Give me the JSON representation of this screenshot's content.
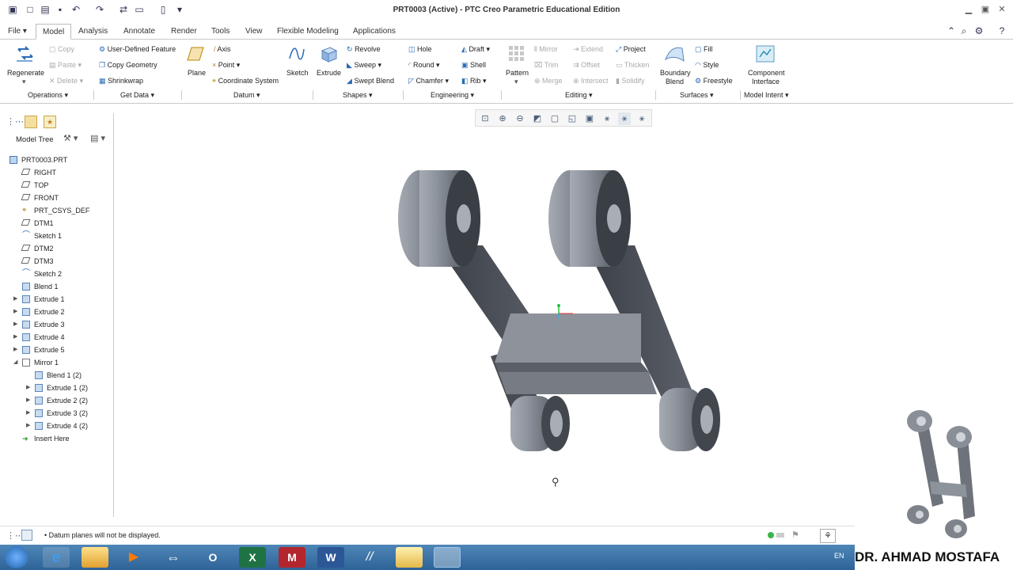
{
  "window": {
    "title": "PRT0003 (Active) - PTC Creo Parametric Educational Edition"
  },
  "tabs": [
    "File",
    "Model",
    "Analysis",
    "Annotate",
    "Render",
    "Tools",
    "View",
    "Flexible Modeling",
    "Applications"
  ],
  "ribbon": {
    "regenerate": "Regenerate",
    "copy": "Copy",
    "paste": "Paste",
    "delete": "Delete",
    "udf": "User-Defined Feature",
    "copy_geometry": "Copy Geometry",
    "shrinkwrap": "Shrinkwrap",
    "plane": "Plane",
    "axis": "Axis",
    "point": "Point",
    "coordinate_system": "Coordinate System",
    "sketch": "Sketch",
    "extrude": "Extrude",
    "revolve": "Revolve",
    "sweep": "Sweep",
    "swept_blend": "Swept Blend",
    "hole": "Hole",
    "round": "Round",
    "chamfer": "Chamfer",
    "draft": "Draft",
    "shell": "Shell",
    "rib": "Rib",
    "pattern": "Pattern",
    "mirror": "Mirror",
    "trim": "Trim",
    "merge": "Merge",
    "extend": "Extend",
    "offset": "Offset",
    "intersect": "Intersect",
    "project": "Project",
    "thicken": "Thicken",
    "solidify": "Solidify",
    "boundary_blend_1": "Boundary",
    "boundary_blend_2": "Blend",
    "fill": "Fill",
    "style": "Style",
    "freestyle": "Freestyle",
    "component_interface_1": "Component",
    "component_interface_2": "Interface",
    "groups": [
      "Operations",
      "Get Data",
      "Datum",
      "Shapes",
      "Engineering",
      "Editing",
      "Surfaces",
      "Model Intent"
    ]
  },
  "model_tree": {
    "header": "Model Tree",
    "items": [
      "PRT0003.PRT",
      "RIGHT",
      "TOP",
      "FRONT",
      "PRT_CSYS_DEF",
      "DTM1",
      "Sketch 1",
      "DTM2",
      "DTM3",
      "Sketch 2",
      "Blend 1",
      "Extrude 1",
      "Extrude 2",
      "Extrude 3",
      "Extrude 4",
      "Extrude 5",
      "Mirror 1",
      "Blend 1 (2)",
      "Extrude 1 (2)",
      "Extrude 2 (2)",
      "Extrude 3 (2)",
      "Extrude 4 (2)",
      "Insert Here"
    ]
  },
  "status": {
    "message": "Datum planes will not be displayed."
  },
  "taskbar": {
    "language": "EN"
  },
  "watermark": {
    "text": "DR. AHMAD MOSTAFA"
  }
}
